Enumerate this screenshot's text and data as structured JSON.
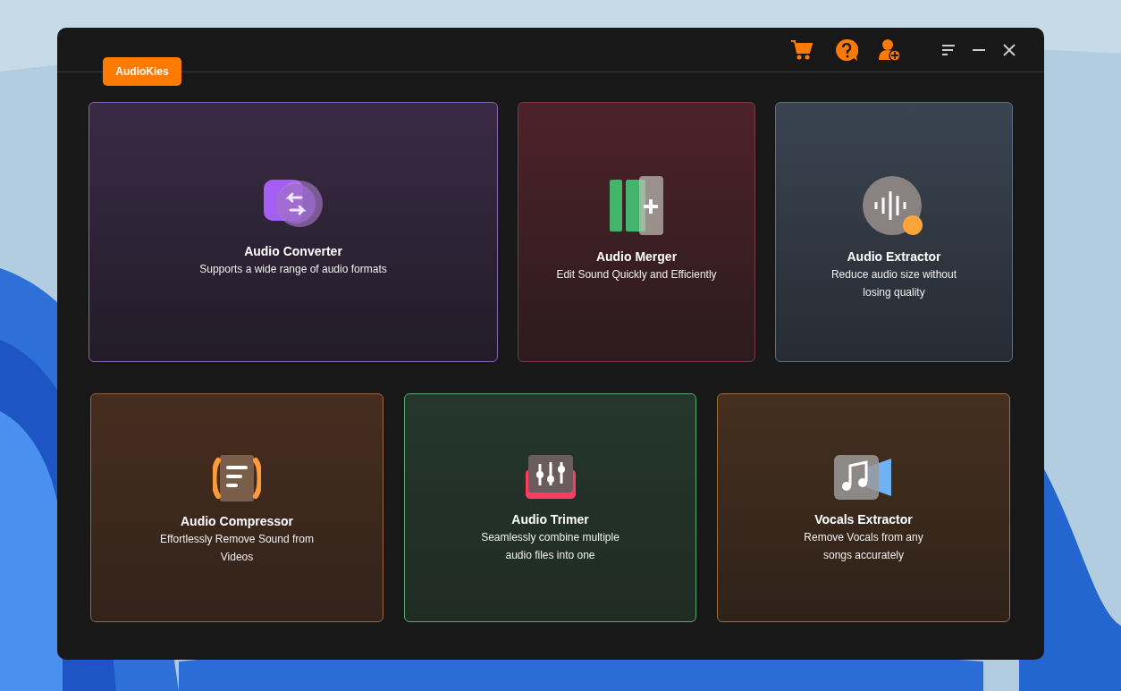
{
  "window": {
    "logo": "AudioKies"
  },
  "toolbar": [
    {
      "kind": "cart"
    },
    {
      "kind": "help"
    },
    {
      "kind": "account"
    },
    {
      "kind": "menu"
    },
    {
      "kind": "minimize"
    },
    {
      "kind": "close"
    }
  ],
  "rows": [
    {
      "cards": [
        {
          "kind": "converter",
          "title": "Audio Converter",
          "description": "Supports a wide range of audio formats"
        },
        {
          "kind": "merger",
          "title": "Audio Merger",
          "description": "Edit Sound Quickly and Efficiently"
        },
        {
          "kind": "extractor",
          "title": "Audio Extractor",
          "description": "Reduce audio size without losing quality"
        }
      ]
    },
    {
      "cards": [
        {
          "kind": "compressor",
          "title": "Audio Compressor",
          "description": "Effortlessly Remove Sound from Videos"
        },
        {
          "kind": "trimmer",
          "title": "Audio Trimer",
          "description": "Seamlessly combine multiple audio files into one"
        },
        {
          "kind": "vocals",
          "title": "Vocals Extractor",
          "description": "Remove Vocals from any songs accurately"
        }
      ]
    }
  ]
}
